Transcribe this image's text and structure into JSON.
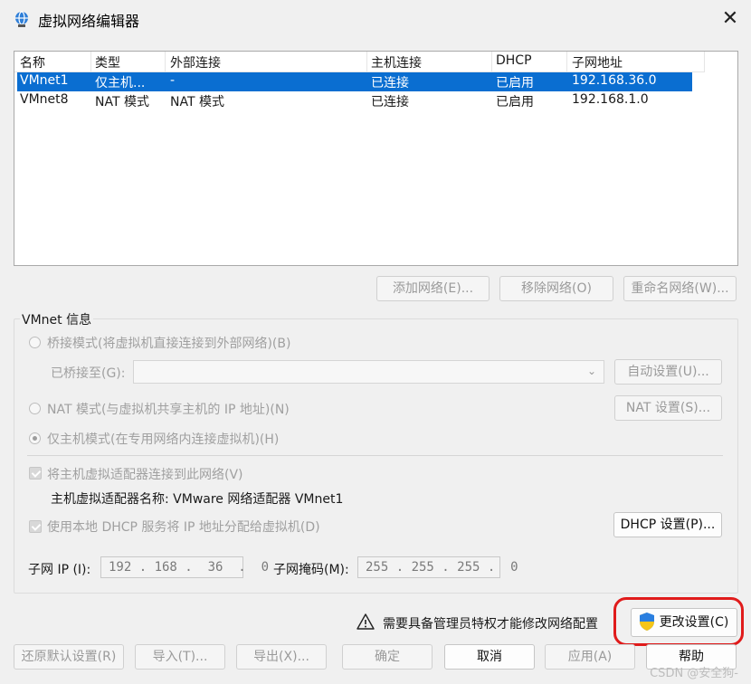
{
  "window": {
    "title": "虚拟网络编辑器",
    "close_glyph": "✕"
  },
  "network_list": {
    "columns": [
      "名称",
      "类型",
      "外部连接",
      "主机连接",
      "DHCP",
      "子网地址"
    ],
    "rows": [
      {
        "name": "VMnet1",
        "type": "仅主机...",
        "external": "-",
        "host": "已连接",
        "dhcp": "已启用",
        "subnet": "192.168.36.0",
        "selected": true
      },
      {
        "name": "VMnet8",
        "type": "NAT 模式",
        "external": "NAT 模式",
        "host": "已连接",
        "dhcp": "已启用",
        "subnet": "192.168.1.0",
        "selected": false
      }
    ]
  },
  "list_buttons": {
    "add": "添加网络(E)...",
    "remove": "移除网络(O)",
    "rename": "重命名网络(W)..."
  },
  "vmnet_info": {
    "label": "VMnet 信息",
    "bridge_mode": "桥接模式(将虚拟机直接连接到外部网络)(B)",
    "bridged_to_label": "已桥接至(G):",
    "auto_settings": "自动设置(U)...",
    "nat_mode": "NAT 模式(与虚拟机共享主机的 IP 地址)(N)",
    "nat_settings": "NAT 设置(S)...",
    "host_only_mode": "仅主机模式(在专用网络内连接虚拟机)(H)",
    "connect_adapter": "将主机虚拟适配器连接到此网络(V)",
    "adapter_name": "主机虚拟适配器名称: VMware 网络适配器 VMnet1",
    "use_dhcp": "使用本地 DHCP 服务将 IP 地址分配给虚拟机(D)",
    "dhcp_settings": "DHCP 设置(P)...",
    "subnet_ip_label": "子网 IP (I):",
    "subnet_ip": "192 . 168 .  36  .  0",
    "subnet_mask_label": "子网掩码(M):",
    "subnet_mask": "255 . 255 . 255 .  0"
  },
  "admin": {
    "warning": "需要具备管理员特权才能修改网络配置",
    "change_settings": "更改设置(C)"
  },
  "footer": {
    "restore": "还原默认设置(R)",
    "import": "导入(T)...",
    "export": "导出(X)...",
    "ok": "确定",
    "cancel": "取消",
    "apply": "应用(A)",
    "help": "帮助"
  },
  "watermark": "CSDN @安全狗-",
  "colors": {
    "selection": "#0a6ed1",
    "highlight_ring": "#e01b1b"
  },
  "icons": [
    "network-globe-icon",
    "close-icon",
    "chevron-down-icon",
    "warning-icon",
    "uac-shield-icon"
  ]
}
